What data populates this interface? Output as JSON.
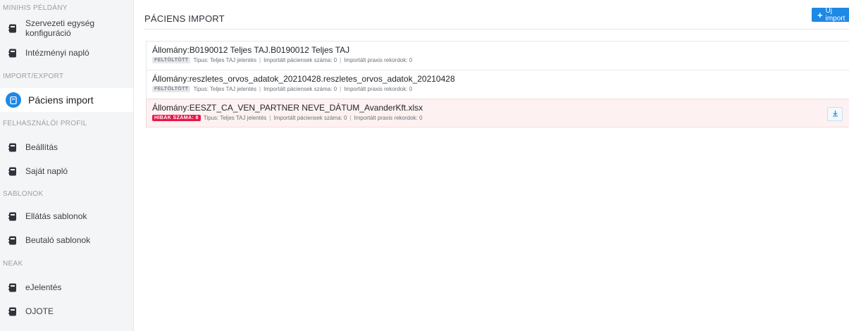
{
  "sidebar": {
    "sections": [
      {
        "title": "MINIHIS PÉLDÁNY",
        "items": [
          {
            "label_line1": "Szervezeti egység",
            "label_line2": "konfiguráció",
            "icon": "book-icon"
          },
          {
            "label": "Intézményi napló",
            "icon": "book-icon"
          }
        ]
      },
      {
        "title": "IMPORT/EXPORT",
        "items": [
          {
            "label": "Páciens import",
            "icon": "book-icon",
            "active": true
          }
        ]
      },
      {
        "title": "FELHASZNÁLÓI PROFIL",
        "items": [
          {
            "label": "Beállítás",
            "icon": "book-icon"
          },
          {
            "label": "Saját napló",
            "icon": "book-icon"
          }
        ]
      },
      {
        "title": "SABLONOK",
        "items": [
          {
            "label": "Ellátás sablonok",
            "icon": "book-icon"
          },
          {
            "label": "Beutaló sablonok",
            "icon": "book-icon"
          }
        ]
      },
      {
        "title": "NEAK",
        "items": [
          {
            "label": "eJelentés",
            "icon": "book-icon"
          },
          {
            "label": "OJOTE",
            "icon": "book-icon"
          }
        ]
      }
    ]
  },
  "main": {
    "title": "PÁCIENS IMPORT",
    "new_import_label": "Új import",
    "imports": [
      {
        "file": "Állomány:B0190012 Teljes TAJ.B0190012 Teljes TAJ",
        "badge": "FELTÖLTÖTT",
        "type": "Tipus: Teljes TAJ jelentés",
        "patients": "Importált páciensek száma: 0",
        "records": "Importált praxis rekordok: 0"
      },
      {
        "file": "Állomány:reszletes_orvos_adatok_20210428.reszletes_orvos_adatok_20210428",
        "badge": "FELTÖLTÖTT",
        "type": "Tipus: Teljes TAJ jelentés",
        "patients": "Importált páciensek száma: 0",
        "records": "Importált praxis rekordok: 0"
      },
      {
        "file": "Állomány:EESZT_CA_VEN_PARTNER NEVE_DÁTUM_AvanderKft.xlsx",
        "badge": "HIBÁK SZÁMA: 8",
        "type": "Tipus: Teljes TAJ jelentés",
        "patients": "Importált páciensek száma: 0",
        "records": "Importált praxis rekordok: 0"
      }
    ]
  },
  "colors": {
    "accent": "#1e88e5",
    "error_badge": "#e8174a",
    "error_row": "#fdf1f1"
  }
}
